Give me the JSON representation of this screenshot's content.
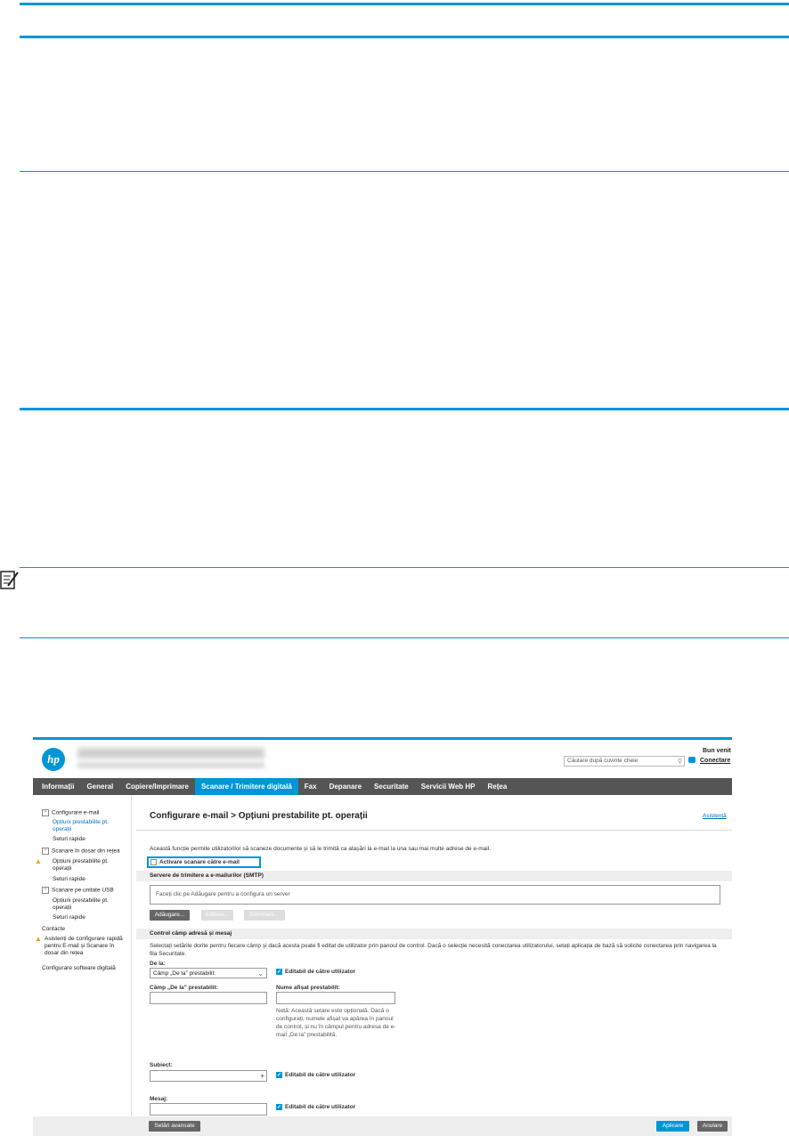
{
  "header": {
    "logo_text": "hp",
    "search_placeholder": "Căutare după cuvinte cheie",
    "welcome": "Bun venit",
    "connect": "Conectare"
  },
  "nav": {
    "tabs": [
      "Informații",
      "General",
      "Copiere/Imprimare",
      "Scanare / Trimitere digitală",
      "Fax",
      "Depanare",
      "Securitate",
      "Servicii Web HP",
      "Rețea"
    ],
    "active_index": 3
  },
  "sidebar": {
    "email_setup": "Configurare e-mail",
    "default_job_options": "Opțiuni prestabilite pt. operații",
    "quick_sets": "Seturi rapide",
    "network_folder": "Scanare în dosar din rețea",
    "usb": "Scanare pe unitate USB",
    "contacts": "Contacte",
    "quick_setup": "Asistenți de configurare rapidă pentru E-mail și Scanare în dosar din rețea",
    "digital_software": "Configurare software digitală"
  },
  "main": {
    "title": "Configurare e-mail > Opțiuni prestabilite pt. operații",
    "help": "Asistență",
    "description": "Această funcție permite utilizatorilor să scaneze documente și să le trimită ca atașări la e-mail la una sau mai multe adrese de e-mail.",
    "enable_scan": "Activare scanare către e-mail",
    "smtp_section": "Servere de trimitere a e-mailurilor (SMTP)",
    "smtp_placeholder": "Faceți clic pe Adăugare pentru a configura un server",
    "add_btn": "Adăugare...",
    "edit_btn": "Editare...",
    "remove_btn": "Eliminare...",
    "address_section": "Control câmp adresă și mesaj",
    "address_desc": "Selectați setările dorite pentru fiecare câmp și dacă acesta poate fi editat de utilizator prin panoul de control. Dacă o selecție necesită conectarea utilizatorului, setați aplicația de bază să solicite conectarea prin navigarea la fila Securitate.",
    "from_label": "De la:",
    "from_value": "Câmp „De la” prestabilit:",
    "editable": "Editabil de către utilizator",
    "default_from_label": "Câmp „De la” prestabilit:",
    "display_name_label": "Nume afișat prestabilit:",
    "note": "Notă: Această setare este opțională. Dacă o configurați, numele afișat va apărea în panoul de control, și nu în câmpul pentru adresa de e-mail „De la” prestabilită.",
    "subject_label": "Subiect:",
    "message_label": "Mesaj:"
  },
  "footer": {
    "advanced": "Setări avansate",
    "apply": "Aplicare",
    "cancel": "Anulare"
  }
}
